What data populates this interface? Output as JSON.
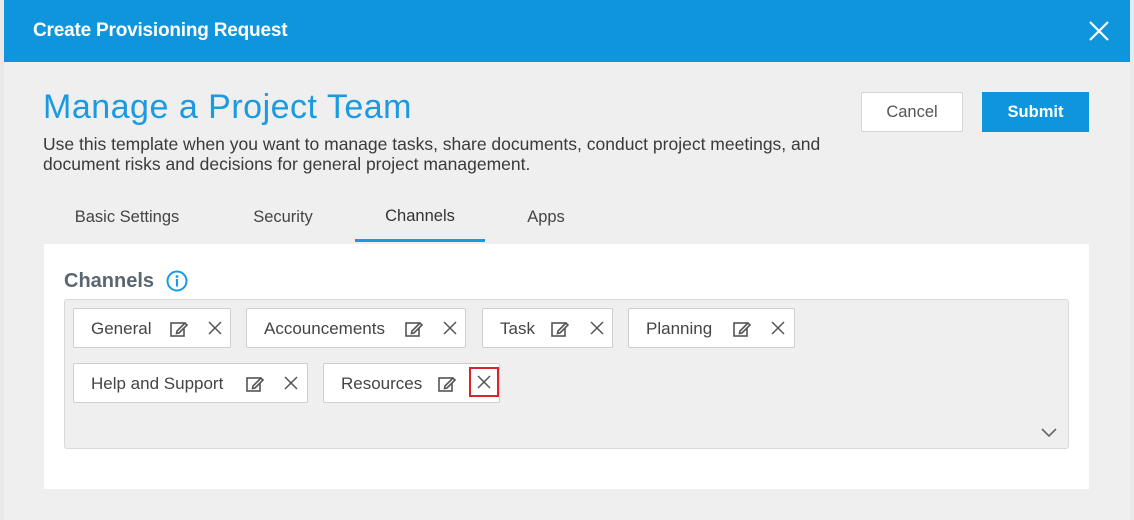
{
  "dialog": {
    "title": "Create Provisioning Request"
  },
  "page": {
    "title": "Manage a Project Team",
    "description": "Use this template when you want to manage tasks, share documents, conduct project meetings, and document risks and decisions for general project management."
  },
  "actions": {
    "cancel_label": "Cancel",
    "submit_label": "Submit"
  },
  "tabs": [
    {
      "label": "Basic Settings",
      "active": false
    },
    {
      "label": "Security",
      "active": false
    },
    {
      "label": "Channels",
      "active": true
    },
    {
      "label": "Apps",
      "active": false
    }
  ],
  "channels": {
    "heading": "Channels",
    "info_icon": "info-icon",
    "items": [
      {
        "label": "General"
      },
      {
        "label": "Accouncements"
      },
      {
        "label": "Task"
      },
      {
        "label": "Planning"
      },
      {
        "label": "Help and Support"
      },
      {
        "label": "Resources"
      }
    ]
  },
  "colors": {
    "accent": "#0f95dc",
    "highlight": "#d9232e"
  }
}
